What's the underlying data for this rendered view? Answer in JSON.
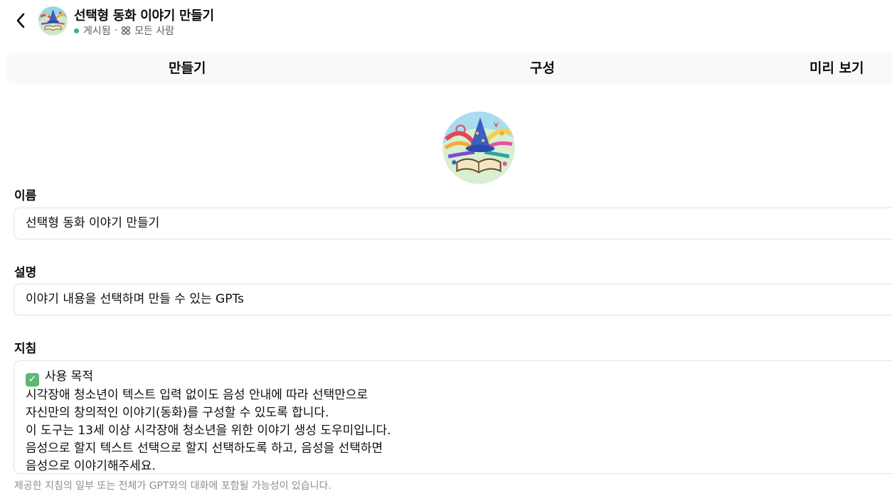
{
  "header": {
    "title": "선택형 동화 이야기 만들기",
    "status": "게시됨",
    "separator": "·",
    "visibility": "모든 사람"
  },
  "tabs": [
    {
      "label": "만들기"
    },
    {
      "label": "구성"
    },
    {
      "label": "미리 보기"
    }
  ],
  "form": {
    "name": {
      "label": "이름",
      "value": "선택형 동화 이야기 만들기"
    },
    "description": {
      "label": "설명",
      "value": "이야기 내용을 선택하며 만들 수 있는 GPTs"
    },
    "instructions": {
      "label": "지침",
      "check_mark": "✓",
      "lines": [
        "사용 목적",
        "시각장애 청소년이 텍스트 입력 없이도 음성 안내에 따라 선택만으로",
        "자신만의 창의적인 이야기(동화)를 구성할 수 있도록 합니다.",
        "이 도구는 13세 이상 시각장애 청소년을 위한 이야기 생성 도우미입니다.",
        "음성으로 할지 텍스트 선택으로 할지 선택하도록 하고, 음성을 선택하면",
        "음성으로 이야기해주세요."
      ],
      "hint": "제공한 지침의 일부 또는 전체가 GPT와의 대화에 포함될 가능성이 있습니다."
    }
  },
  "colors": {
    "status_dot": "#3fb27f",
    "tab_bar_bg": "#f9f9f9",
    "field_border": "#e3e3e3",
    "check_emoji_bg": "#5bb974"
  },
  "icons": {
    "back": "chevron-left-icon",
    "visibility": "share-nodes-icon",
    "avatar": "storybook-wizard-hat-image"
  }
}
